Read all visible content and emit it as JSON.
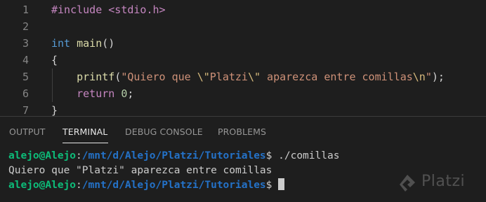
{
  "editor": {
    "lines": [
      {
        "num": "1",
        "parts": [
          {
            "cls": "kw-pre",
            "text": "#include <stdio.h>"
          }
        ]
      },
      {
        "num": "2",
        "parts": []
      },
      {
        "num": "3",
        "parts": [
          {
            "cls": "kw",
            "text": "int"
          },
          {
            "cls": "",
            "text": " "
          },
          {
            "cls": "fn",
            "text": "main"
          },
          {
            "cls": "",
            "text": "()"
          }
        ]
      },
      {
        "num": "4",
        "parts": [
          {
            "cls": "",
            "text": "{"
          }
        ]
      },
      {
        "num": "5",
        "parts": [
          {
            "cls": "",
            "text": "    "
          },
          {
            "cls": "fn",
            "text": "printf"
          },
          {
            "cls": "",
            "text": "("
          },
          {
            "cls": "str",
            "text": "\"Quiero que "
          },
          {
            "cls": "esc",
            "text": "\\\""
          },
          {
            "cls": "str",
            "text": "Platzi"
          },
          {
            "cls": "esc",
            "text": "\\\""
          },
          {
            "cls": "str",
            "text": " aparezca entre comillas"
          },
          {
            "cls": "esc",
            "text": "\\n"
          },
          {
            "cls": "str",
            "text": "\""
          },
          {
            "cls": "",
            "text": ");"
          }
        ]
      },
      {
        "num": "6",
        "parts": [
          {
            "cls": "",
            "text": "    "
          },
          {
            "cls": "ctl",
            "text": "return"
          },
          {
            "cls": "",
            "text": " "
          },
          {
            "cls": "num",
            "text": "0"
          },
          {
            "cls": "",
            "text": ";"
          }
        ]
      },
      {
        "num": "7",
        "parts": [
          {
            "cls": "",
            "text": "}"
          }
        ]
      }
    ]
  },
  "panel": {
    "tabs": {
      "output": "OUTPUT",
      "terminal": "TERMINAL",
      "debug_console": "DEBUG CONSOLE",
      "problems": "PROBLEMS"
    },
    "active_tab": "TERMINAL"
  },
  "terminal": {
    "prompt_user": "alejo@Alejo",
    "prompt_sep": ":",
    "prompt_path": "/mnt/d/Alejo/Platzi/Tutoriales",
    "prompt_symbol": "$ ",
    "command": "./comillas",
    "output": "Quiero que \"Platzi\" aparezca entre comillas"
  },
  "watermark": {
    "text": "Platzi",
    "icon": "platzi-logo-icon"
  },
  "colors": {
    "background": "#1e1e1e",
    "prompt_user": "#0dbc79",
    "prompt_path": "#2472c8"
  }
}
